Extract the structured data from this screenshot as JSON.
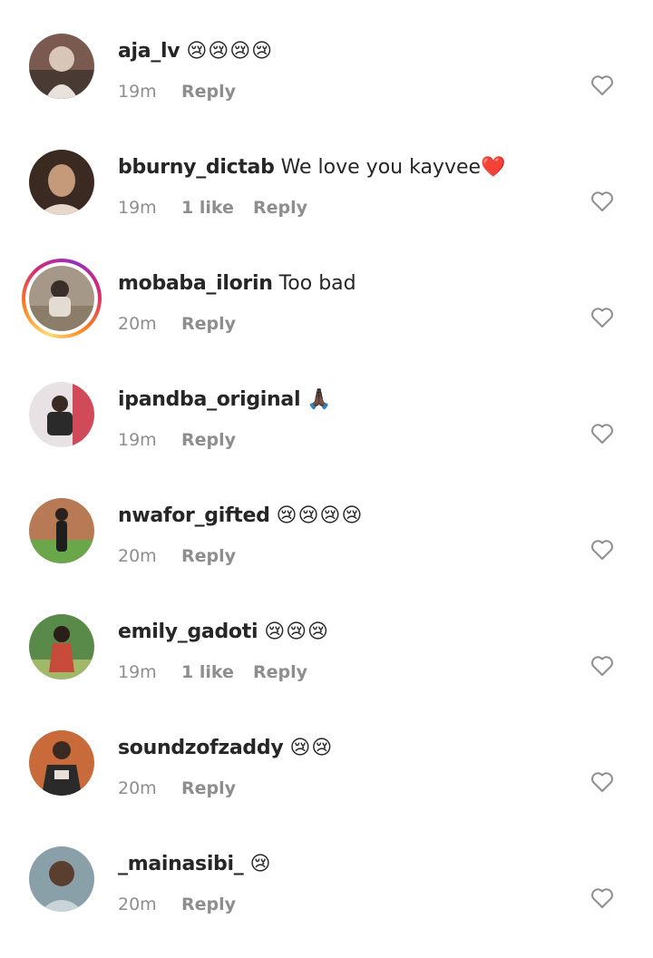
{
  "comments": [
    {
      "username": "aja_lv",
      "text": "",
      "emojis": "😢😢😢😢",
      "time": "19m",
      "likes": "",
      "reply": "Reply",
      "avatar_colors": [
        "#7a5a4e",
        "#d8c6b8"
      ],
      "story_ring": false
    },
    {
      "username": "bburny_dictab",
      "text": "We love you kayvee",
      "emojis": "❤️",
      "time": "19m",
      "likes": "1 like",
      "reply": "Reply",
      "avatar_colors": [
        "#3a2a22",
        "#c49a7a"
      ],
      "story_ring": false
    },
    {
      "username": "mobaba_ilorin",
      "text": "Too bad",
      "emojis": "",
      "time": "20m",
      "likes": "",
      "reply": "Reply",
      "avatar_colors": [
        "#a59888",
        "#e4dcd2"
      ],
      "story_ring": true
    },
    {
      "username": "ipandba_original",
      "text": "",
      "emojis": "🙏🏿",
      "time": "19m",
      "likes": "",
      "reply": "Reply",
      "avatar_colors": [
        "#e8e2e4",
        "#d04a5a"
      ],
      "story_ring": false
    },
    {
      "username": "nwafor_gifted",
      "text": "",
      "emojis": "😢😢😢😢",
      "time": "20m",
      "likes": "",
      "reply": "Reply",
      "avatar_colors": [
        "#b87a54",
        "#6aa64a"
      ],
      "story_ring": false
    },
    {
      "username": "emily_gadoti",
      "text": "",
      "emojis": "😢😢😢",
      "time": "19m",
      "likes": "1 like",
      "reply": "Reply",
      "avatar_colors": [
        "#5a8a4a",
        "#c84a3a"
      ],
      "story_ring": false
    },
    {
      "username": "soundzofzaddy",
      "text": "",
      "emojis": "😢😢",
      "time": "20m",
      "likes": "",
      "reply": "Reply",
      "avatar_colors": [
        "#c86a3a",
        "#2a2a2a"
      ],
      "story_ring": false
    },
    {
      "username": "_mainasibi_",
      "text": "",
      "emojis": "😢",
      "time": "20m",
      "likes": "",
      "reply": "Reply",
      "avatar_colors": [
        "#8aa0a8",
        "#c8d4d8"
      ],
      "story_ring": false
    }
  ],
  "icons": {
    "like": "heart-outline-icon"
  }
}
